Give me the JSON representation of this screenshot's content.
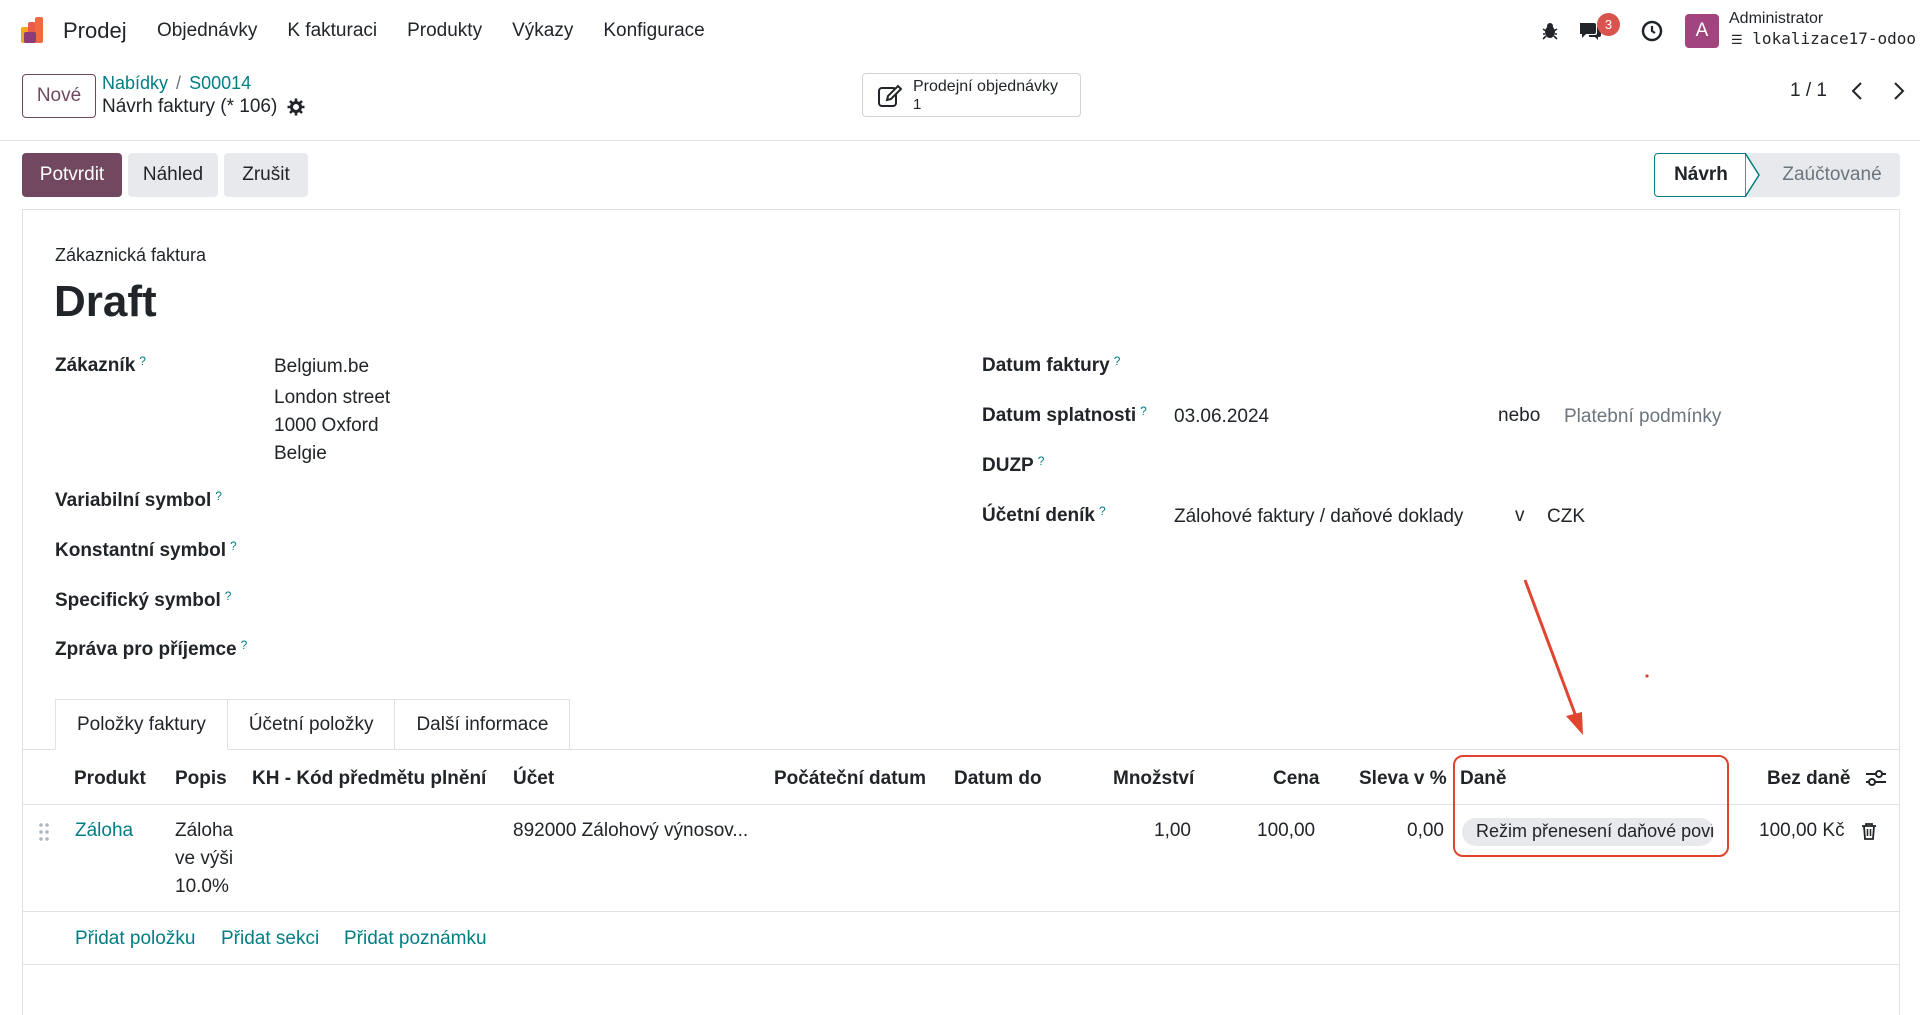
{
  "navbar": {
    "app_name": "Prodej",
    "menu": [
      "Objednávky",
      "K fakturaci",
      "Produkty",
      "Výkazy",
      "Konfigurace"
    ],
    "messages_count": "3",
    "avatar_letter": "A",
    "user_name": "Administrator",
    "database": "lokalizace17-odoo"
  },
  "control": {
    "new_label": "Nové",
    "breadcrumb": [
      "Nabídky",
      "S00014"
    ],
    "record_title": "Návrh faktury (* 106)",
    "smart_button_label": "Prodejní objednávky",
    "smart_button_count": "1",
    "pager": "1 / 1"
  },
  "statusbar": {
    "confirm_label": "Potvrdit",
    "preview_label": "Náhled",
    "cancel_label": "Zrušit",
    "stages": [
      "Návrh",
      "Zaúčtované"
    ],
    "active_stage": "Návrh"
  },
  "form": {
    "doc_type": "Zákaznická faktura",
    "doc_name": "Draft",
    "customer_label": "Zákazník",
    "customer_name": "Belgium.be",
    "customer_address": [
      "London street",
      "1000 Oxford",
      "Belgie"
    ],
    "variable_symbol_label": "Variabilní symbol",
    "constant_symbol_label": "Konstantní symbol",
    "specific_symbol_label": "Specifický symbol",
    "message_label": "Zpráva pro příjemce",
    "invoice_date_label": "Datum faktury",
    "due_date_label": "Datum splatnosti",
    "due_date_value": "03.06.2024",
    "or_label": "nebo",
    "payment_terms_placeholder": "Platební podmínky",
    "duzp_label": "DUZP",
    "journal_label": "Účetní deník",
    "journal_value": "Zálohové faktury / daňové doklady",
    "in_label": "v",
    "currency": "CZK",
    "help_mark": "?"
  },
  "tabs": [
    "Položky faktury",
    "Účetní položky",
    "Další informace"
  ],
  "lines_table": {
    "columns": [
      "Produkt",
      "Popis",
      "KH - Kód předmětu plnění",
      "Účet",
      "Počáteční datum",
      "Datum do",
      "Množství",
      "Cena",
      "Sleva v %",
      "Daně",
      "Bez daně"
    ],
    "rows": [
      {
        "product": "Záloha",
        "description": [
          "Záloha",
          "ve výši",
          "10.0%"
        ],
        "account": "892000 Zálohový výnosov...",
        "quantity": "1,00",
        "price": "100,00",
        "discount": "0,00",
        "tax": "Režim přenesení daňové povinnosti",
        "subtotal": "100,00 Kč"
      }
    ],
    "add_links": [
      "Přidat položku",
      "Přidat sekci",
      "Přidat poznámku"
    ]
  },
  "colors": {
    "brand": "#71485f",
    "link": "#017e84",
    "annotation": "#e2452f",
    "badge": "#d9534f",
    "avatar": "#a2457e"
  }
}
